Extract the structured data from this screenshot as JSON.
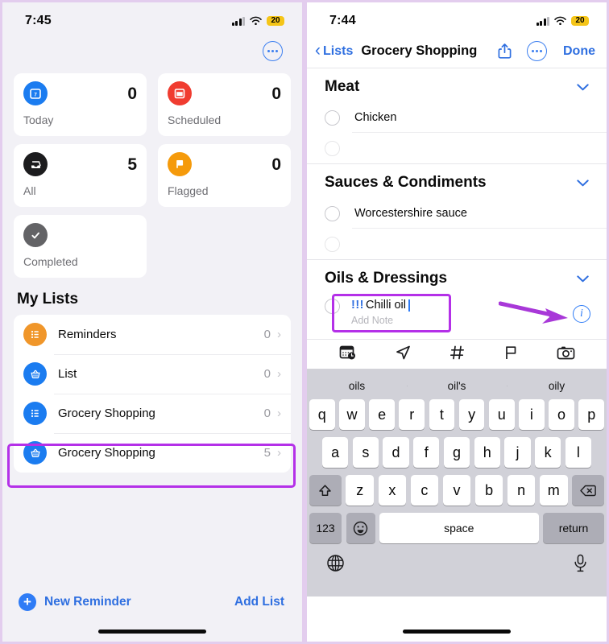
{
  "left": {
    "status": {
      "time": "7:45",
      "battery": "20"
    },
    "more_button": "more-options",
    "smart_cards": [
      {
        "label": "Today",
        "count": "0",
        "color": "#1b7cf0",
        "icon": "calendar-today-icon"
      },
      {
        "label": "Scheduled",
        "count": "0",
        "color": "#f03c30",
        "icon": "calendar-scheduled-icon"
      },
      {
        "label": "All",
        "count": "5",
        "color": "#1c1c1e",
        "icon": "all-inbox-icon"
      },
      {
        "label": "Flagged",
        "count": "0",
        "color": "#f59a0b",
        "icon": "flag-icon"
      },
      {
        "label": "Completed",
        "count": "",
        "color": "#636366",
        "icon": "check-circle-icon"
      }
    ],
    "section_title": "My Lists",
    "lists": [
      {
        "name": "Reminders",
        "count": "0",
        "color": "#f0962a",
        "icon": "bulleted-list-icon",
        "highlighted": false
      },
      {
        "name": "List",
        "count": "0",
        "color": "#1b7cf0",
        "icon": "basket-icon",
        "highlighted": false
      },
      {
        "name": "Grocery Shopping",
        "count": "0",
        "color": "#1b7cf0",
        "icon": "bulleted-list-icon",
        "highlighted": false
      },
      {
        "name": "Grocery Shopping",
        "count": "5",
        "color": "#1b7cf0",
        "icon": "basket-icon",
        "highlighted": true
      }
    ],
    "new_reminder": "New Reminder",
    "add_list": "Add List"
  },
  "right": {
    "status": {
      "time": "7:44",
      "battery": "20"
    },
    "nav": {
      "back": "Lists",
      "title": "Grocery Shopping",
      "share": "share-icon",
      "more": "more-options-icon",
      "done": "Done"
    },
    "groups": [
      {
        "title": "Meat",
        "items": [
          "Chicken",
          ""
        ]
      },
      {
        "title": "Sauces & Condiments",
        "items": [
          "Worcestershire sauce",
          ""
        ]
      }
    ],
    "editing_group": {
      "title": "Oils & Dressings",
      "priority": "!!!",
      "text": "Chilli oil",
      "note_placeholder": "Add Note"
    },
    "quickbar": [
      "calendar-clock-icon",
      "location-arrow-icon",
      "hashtag-icon",
      "flag-icon",
      "camera-icon"
    ],
    "keyboard": {
      "predictions": [
        "oils",
        "oil's",
        "oily"
      ],
      "row1": [
        "q",
        "w",
        "e",
        "r",
        "t",
        "y",
        "u",
        "i",
        "o",
        "p"
      ],
      "row2": [
        "a",
        "s",
        "d",
        "f",
        "g",
        "h",
        "j",
        "k",
        "l"
      ],
      "row3": [
        "z",
        "x",
        "c",
        "v",
        "b",
        "n",
        "m"
      ],
      "shift": "shift-icon",
      "backspace": "backspace-icon",
      "numbers": "123",
      "emoji": "emoji-icon",
      "space": "space",
      "return": "return",
      "globe": "globe-icon",
      "mic": "microphone-icon"
    }
  },
  "annotations": {
    "highlight_color": "#b430e8",
    "arrow_color": "#a838d8"
  }
}
